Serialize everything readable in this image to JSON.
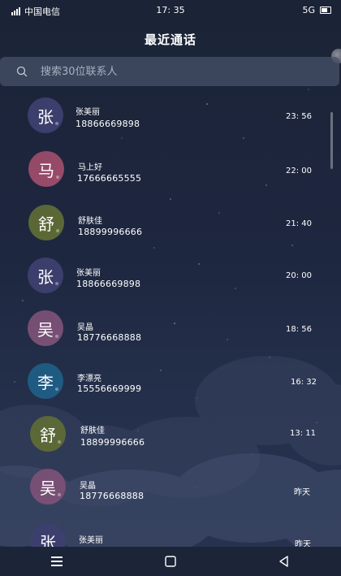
{
  "status_bar": {
    "carrier": "中国电信",
    "time": "17: 35",
    "network": "5G"
  },
  "header": {
    "title": "最近通话"
  },
  "search": {
    "placeholder": "搜索30位联系人",
    "icon": "search-icon"
  },
  "calls": [
    {
      "avatar_char": "张",
      "avatar_color": "#3d3f6e",
      "name": "张美丽",
      "phone": "18866669898",
      "time": "23: 56"
    },
    {
      "avatar_char": "马",
      "avatar_color": "#9b4b6a",
      "name": "马上好",
      "phone": "17666665555",
      "time": "22: 00"
    },
    {
      "avatar_char": "舒",
      "avatar_color": "#5d6a36",
      "name": "舒肤佳",
      "phone": "18899996666",
      "time": "21: 40"
    },
    {
      "avatar_char": "张",
      "avatar_color": "#3d3f6e",
      "name": "张美丽",
      "phone": "18866669898",
      "time": "20: 00"
    },
    {
      "avatar_char": "吴",
      "avatar_color": "#7a5076",
      "name": "吴晶",
      "phone": "18776668888",
      "time": "18: 56"
    },
    {
      "avatar_char": "李",
      "avatar_color": "#1f5c83",
      "name": "李漂亮",
      "phone": "15556669999",
      "time": "16: 32"
    },
    {
      "avatar_char": "舒",
      "avatar_color": "#5d6a36",
      "name": "舒肤佳",
      "phone": "18899996666",
      "time": "13: 11"
    },
    {
      "avatar_char": "吴",
      "avatar_color": "#7a5076",
      "name": "吴晶",
      "phone": "18776668888",
      "time": "昨天"
    },
    {
      "avatar_char": "张",
      "avatar_color": "#3d3f6e",
      "name": "张美丽",
      "phone": "",
      "time": "昨天"
    }
  ],
  "nav": {
    "menu_icon": "menu-icon",
    "home_icon": "home-square-icon",
    "back_icon": "back-triangle-icon"
  }
}
